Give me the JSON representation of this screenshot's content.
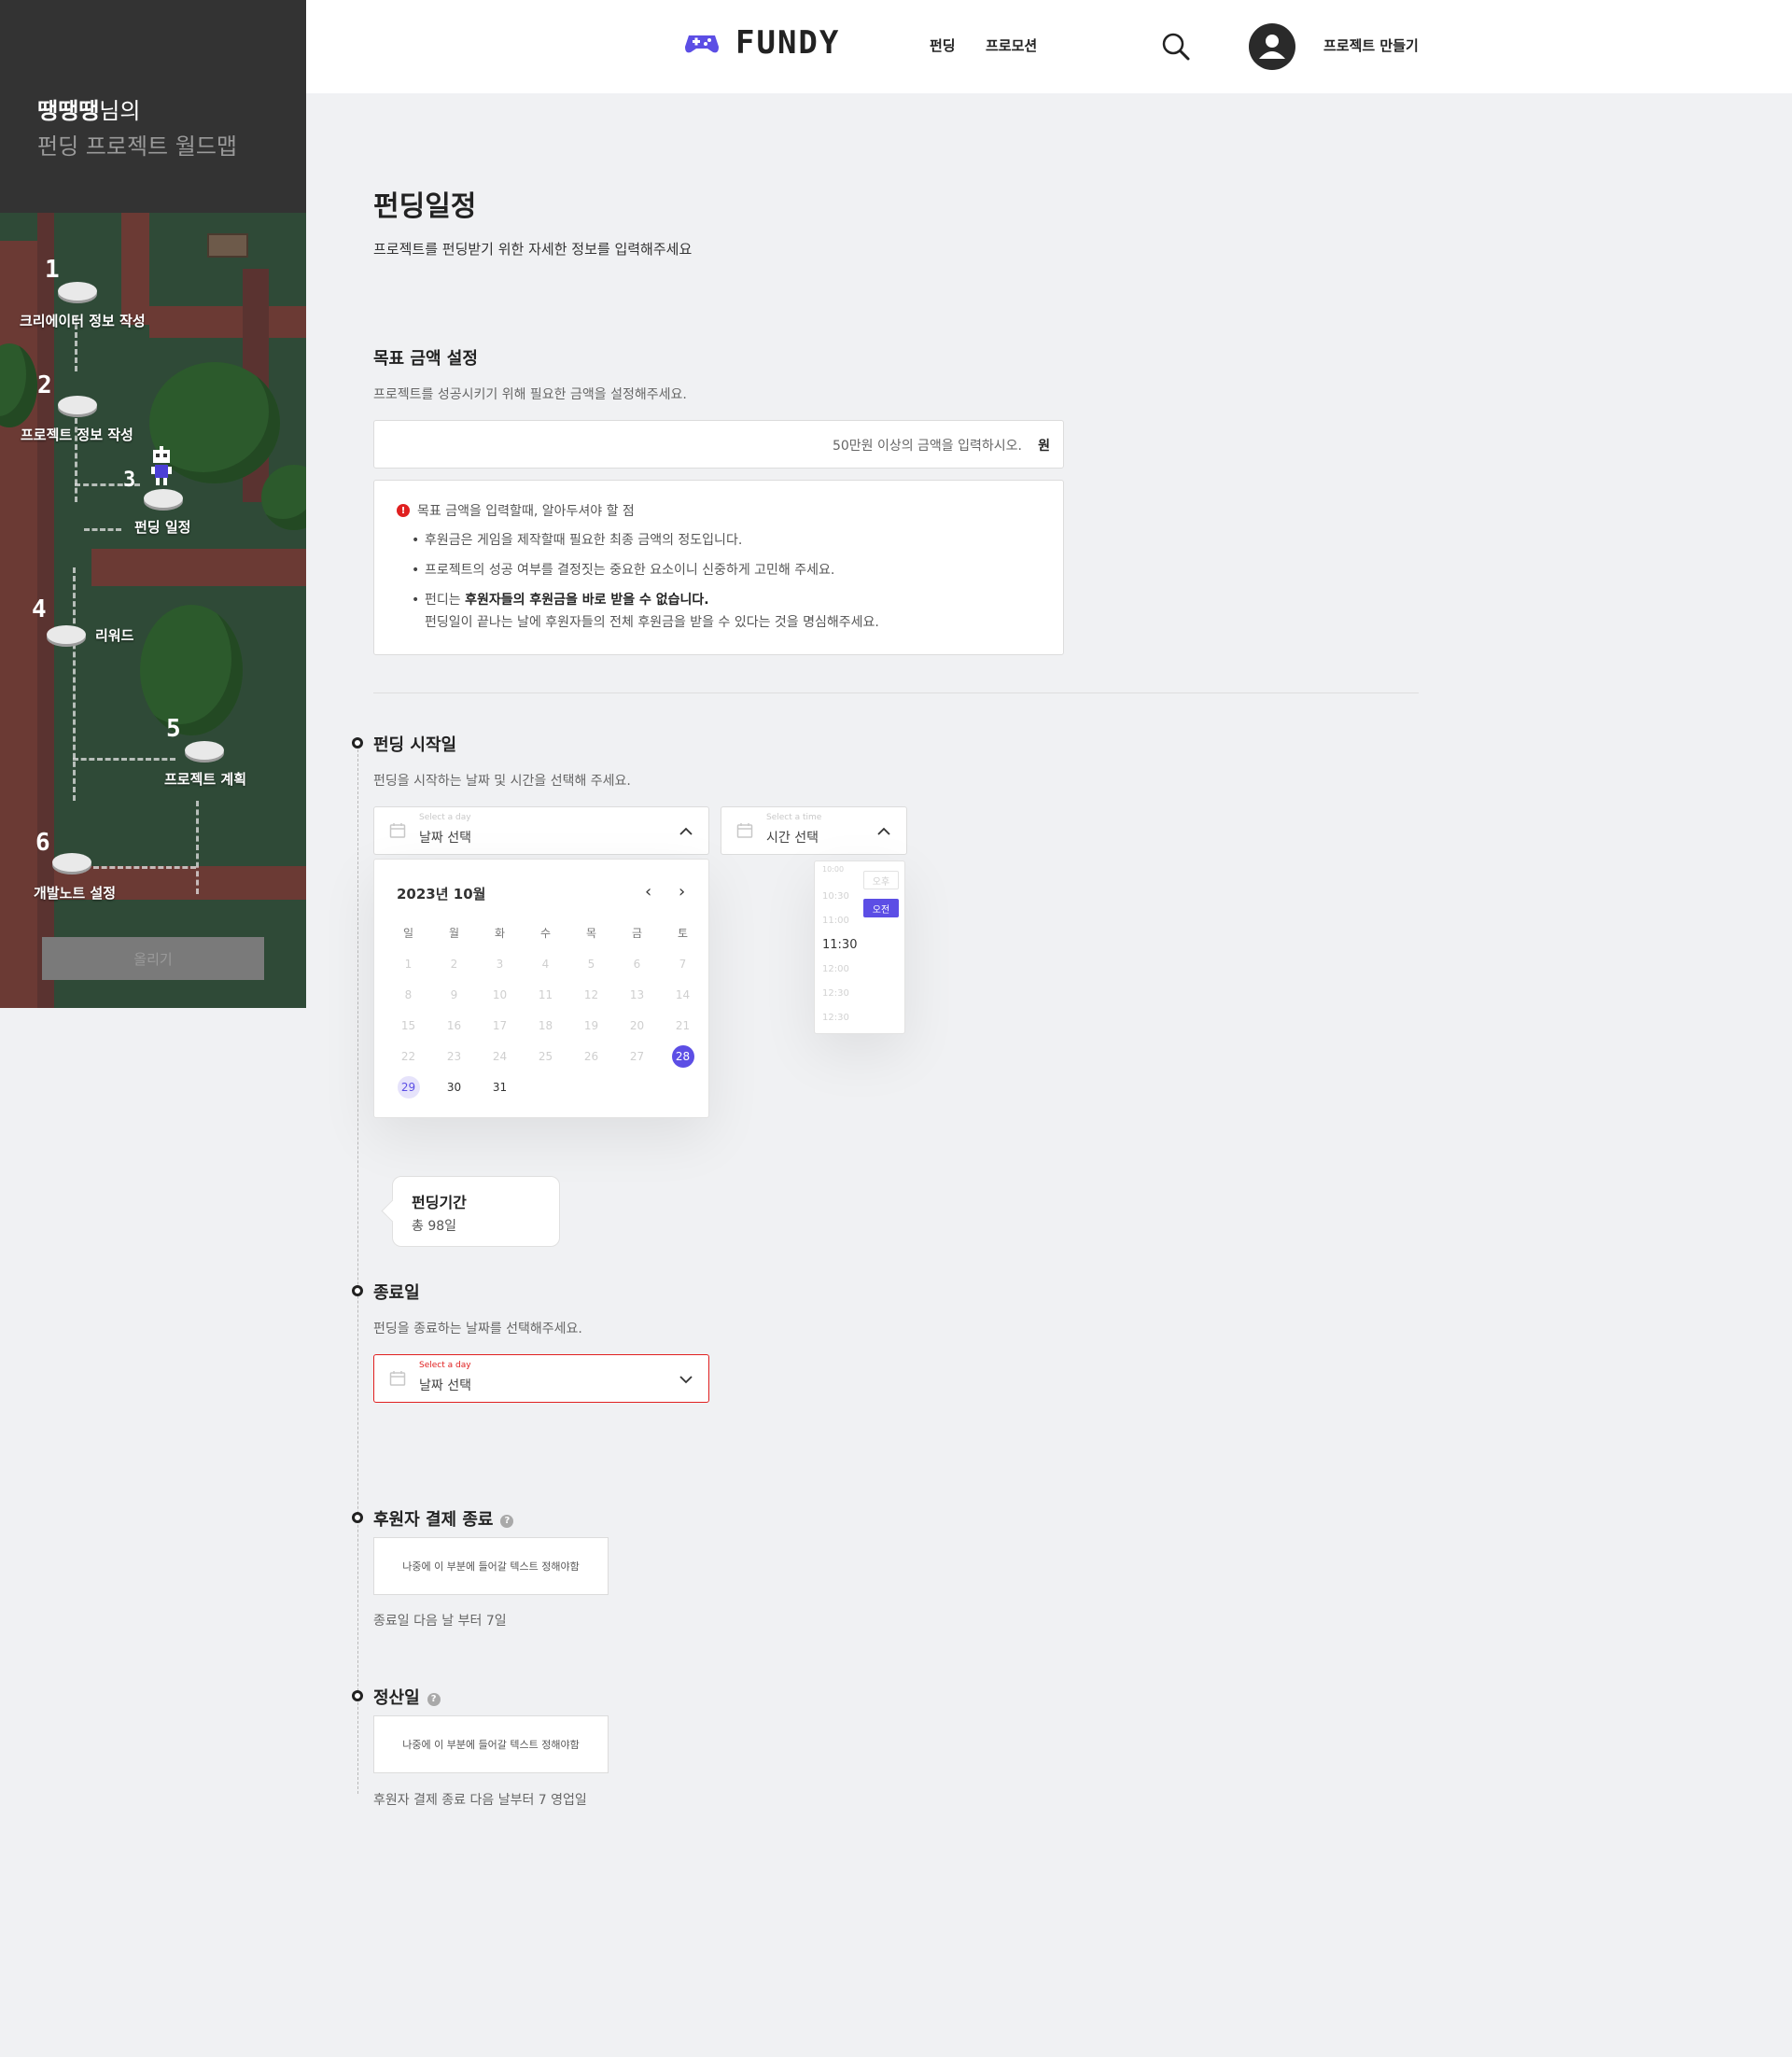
{
  "sidebar": {
    "user": "땡땡땡",
    "user_suffix": "님의",
    "subtitle": "펀딩 프로젝트 월드맵",
    "steps": [
      {
        "num": "1",
        "label": "크리에이터 정보 작성"
      },
      {
        "num": "2",
        "label": "프로젝트 정보 작성"
      },
      {
        "num": "3",
        "label": "펀딩 일정"
      },
      {
        "num": "4",
        "label": "리워드"
      },
      {
        "num": "5",
        "label": "프로젝트 계획"
      },
      {
        "num": "6",
        "label": "개발노트 설정"
      }
    ],
    "upload_label": "올리기"
  },
  "nav": {
    "logo": "FUNDY",
    "links": [
      "펀딩",
      "프로모션"
    ],
    "make_project": "프로젝트 만들기"
  },
  "page": {
    "title": "펀딩일정",
    "subtitle": "프로젝트를 펀딩받기 위한 자세한 정보를 입력해주세요"
  },
  "goal": {
    "title": "목표 금액 설정",
    "desc": "프로젝트를 성공시키기 위해 필요한 금액을 설정해주세요.",
    "placeholder": "50만원 이상의 금액을 입력하시오.",
    "unit": "원",
    "notice_title": "목표 금액을 입력할때, 알아두셔야 할 점",
    "notice_items": [
      "후원금은 게임을 제작할때 필요한 최종 금액의 정도입니다.",
      "프로젝트의 성공 여부를 결정짓는 중요한 요소이니 신중하게 고민해 주세요."
    ],
    "notice_3_pre": "펀디는 ",
    "notice_3_bold": "후원자들의 후원금을 바로 받을 수 없습니다.",
    "notice_3_line2": "펀딩일이 끝나는 날에 후원자들의 전체 후원금을 받을 수 있다는 것을 명심해주세요."
  },
  "start": {
    "title": "펀딩 시작일",
    "desc": "펀딩을 시작하는 날짜 및 시간을 선택해 주세요.",
    "date_mini": "Select a day",
    "date_value": "날짜 선택",
    "time_mini": "Select a time",
    "time_value": "시간 선택"
  },
  "calendar": {
    "month_label": "2023년 10월",
    "weekdays": [
      "일",
      "월",
      "화",
      "수",
      "목",
      "금",
      "토"
    ],
    "days": [
      1,
      2,
      3,
      4,
      5,
      6,
      7,
      8,
      9,
      10,
      11,
      12,
      13,
      14,
      15,
      16,
      17,
      18,
      19,
      20,
      21,
      22,
      23,
      24,
      25,
      26,
      27,
      28,
      29,
      30,
      31
    ],
    "selected_day": 28,
    "highlighted_day": 29
  },
  "timepicker": {
    "times": [
      "10:00",
      "10:30",
      "11:00",
      "11:30",
      "12:00",
      "12:30",
      "12:30"
    ],
    "active_time": "11:30",
    "pm": "오후",
    "am": "오전"
  },
  "period": {
    "title": "펀딩기간",
    "value": "총 98일"
  },
  "end": {
    "title": "종료일",
    "desc": "펀딩을 종료하는 날짜를 선택해주세요.",
    "date_mini": "Select a day",
    "date_value": "날짜 선택"
  },
  "payment_end": {
    "title": "후원자 결제 종료",
    "box_text": "나중에 이 부분에 들어갈 텍스트 정해야함",
    "note": "종료일 다음 날 부터 7일"
  },
  "settlement": {
    "title": "정산일",
    "box_text": "나중에 이 부분에 들어갈 텍스트 정해야함",
    "note": "후원자 결제 종료 다음 날부터 7 영업일"
  },
  "colors": {
    "accent": "#5c4ee5",
    "error": "#e02020",
    "sidebar": "#333333"
  }
}
